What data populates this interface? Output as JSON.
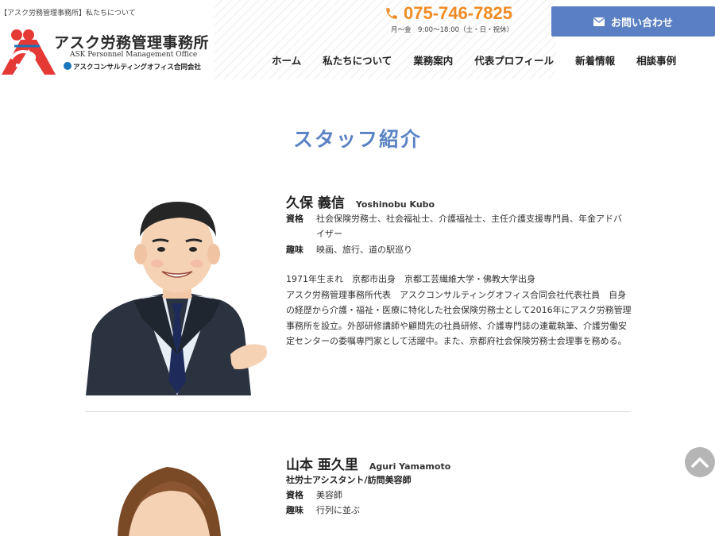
{
  "header": {
    "breadcrumb": "【アスク労務管理事務所】私たちについて",
    "logo": {
      "name": "アスク労務管理事務所",
      "english": "ASK Personnel Management Office",
      "company": "アスクコンサルティングオフィス合同会社"
    },
    "phone": "075-746-7825",
    "hours": "月〜金　9:00〜18:00（土・日・祝休）",
    "contact_button": "お問い合わせ",
    "nav": [
      "ホーム",
      "私たちについて",
      "業務案内",
      "代表プロフィール",
      "新着情報",
      "相談事例"
    ]
  },
  "section_title": "スタッフ紹介",
  "staff": [
    {
      "name": "久保 義信",
      "roman": "Yoshinobu Kubo",
      "qualifications_label": "資格",
      "qualifications": "社会保険労務士、社会福祉士、介護福祉士、主任介護支援専門員、年金アドバイザー",
      "hobbies_label": "趣味",
      "hobbies": "映画、旅行、道の駅巡り",
      "bio": "1971年生まれ　京都市出身　京都工芸繊維大学・佛教大学出身\nアスク労務管理事務所代表　アスクコンサルティングオフィス合同会社代表社員　自身の経歴から介護・福祉・医療に特化した社会保険労務士として2016年にアスク労務管理事務所を設立。外部研修講師や顧問先の社員研修、介護専門誌の連載執筆、介護労働安定センターの委嘱専門家として活躍中。また、京都府社会保険労務士会理事を務める。"
    },
    {
      "name": "山本 亜久里",
      "roman": "Aguri Yamamoto",
      "role": "社労士アシスタント/訪問美容師",
      "qualifications_label": "資格",
      "qualifications": "美容師",
      "hobbies_label": "趣味",
      "hobbies": "行列に並ぶ"
    }
  ],
  "colors": {
    "accent_blue": "#5b83c4",
    "button_blue": "#5a7fc3",
    "phone_orange": "#f08b24",
    "logo_red": "#e53935"
  },
  "icons": [
    "phone-icon",
    "mail-icon",
    "chevron-up-icon"
  ]
}
